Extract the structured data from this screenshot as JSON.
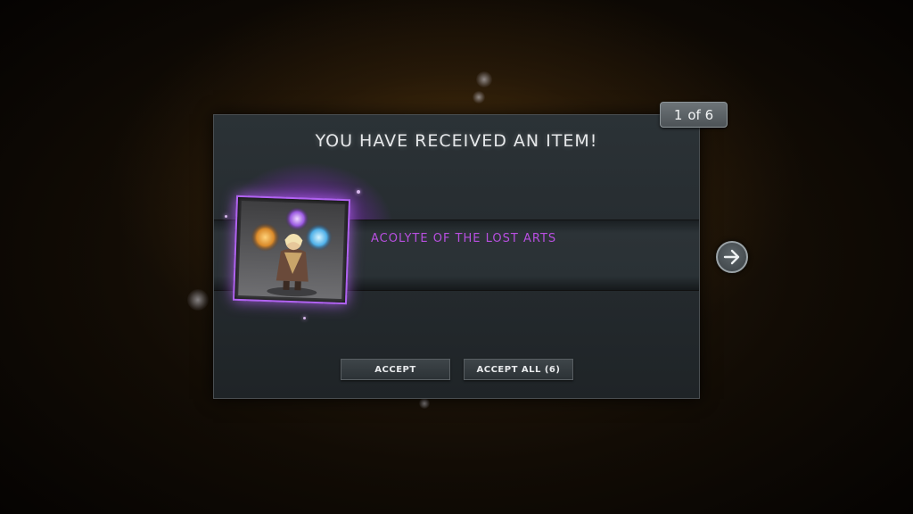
{
  "dialog": {
    "title": "YOU HAVE RECEIVED AN ITEM!",
    "item_name": "ACOLYTE OF THE LOST ARTS",
    "accept_label": "ACCEPT",
    "accept_all_label": "ACCEPT ALL (6)"
  },
  "pager": {
    "current": "1",
    "total_label": "of 6"
  },
  "icons": {
    "next": "arrow-right-icon"
  },
  "colors": {
    "item_rarity": "#b84fe0",
    "glow": "#b062f0",
    "background_glow": "#784e14"
  }
}
